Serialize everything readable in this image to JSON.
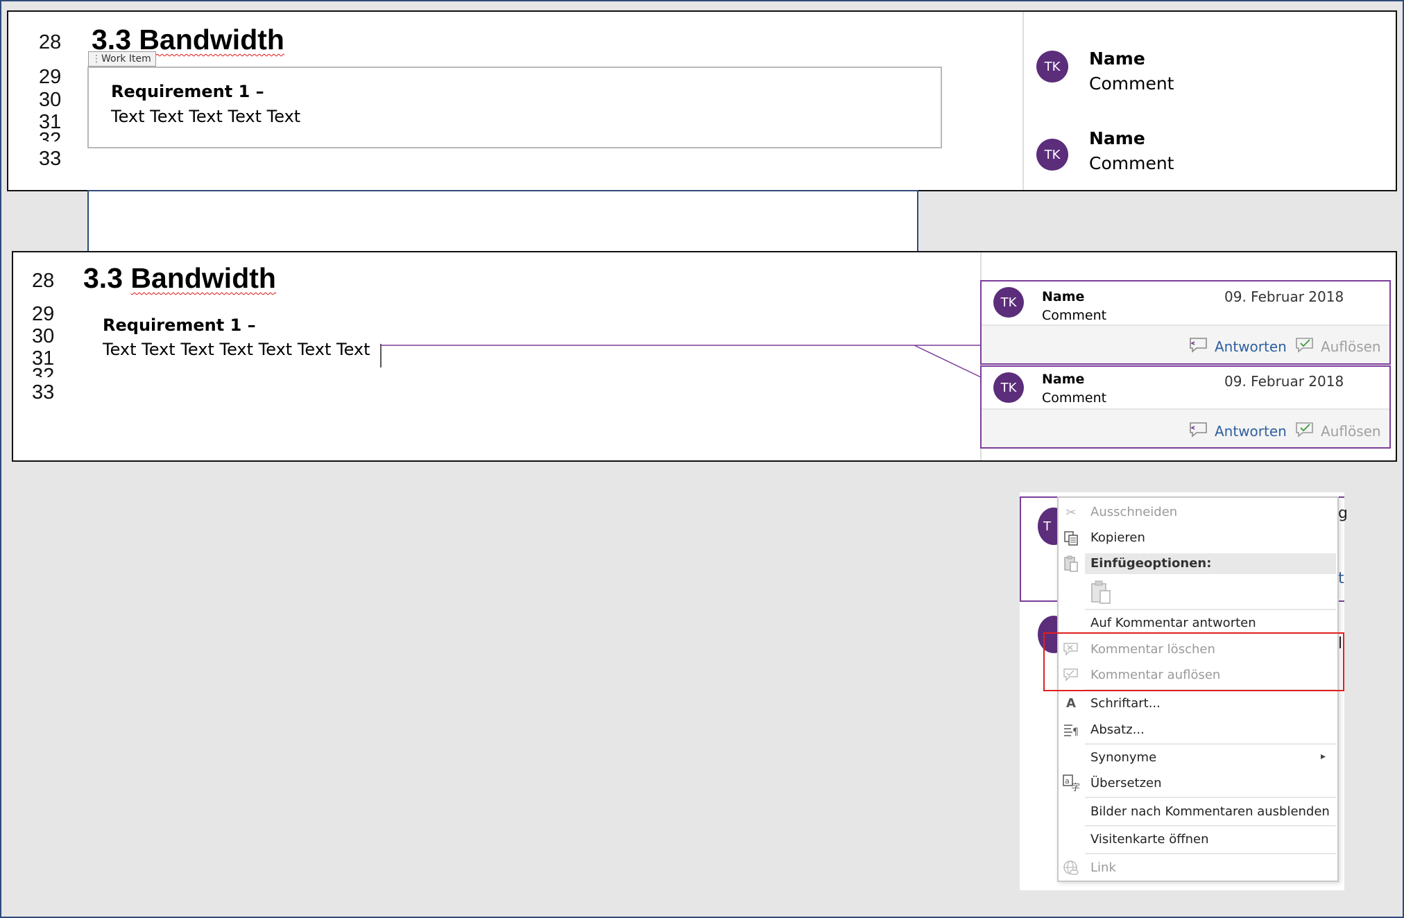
{
  "panel1": {
    "line_numbers": [
      "28",
      "29",
      "30",
      "31",
      "32",
      "33"
    ],
    "heading": "3.3 Bandwidth",
    "heading_number": "3.3",
    "heading_word": "Bandwidth",
    "work_item_label": "Work Item",
    "requirement_title": "Requirement 1 –",
    "requirement_text": "Text Text Text Text Text",
    "comments": [
      {
        "initials": "TK",
        "name": "Name",
        "text": "Comment"
      },
      {
        "initials": "TK",
        "name": "Name",
        "text": "Comment"
      }
    ]
  },
  "panel2": {
    "line_numbers": [
      "28",
      "29",
      "30",
      "31",
      "32",
      "33"
    ],
    "heading": "3.3 Bandwidth",
    "heading_number": "3.3",
    "heading_word": "Bandwidth",
    "requirement_title": "Requirement 1 –",
    "requirement_text": "Text Text Text Text Text Text Text",
    "comments": [
      {
        "initials": "TK",
        "name": "Name",
        "text": "Comment",
        "date": "09. Februar 2018",
        "reply_label": "Antworten",
        "resolve_label": "Auflösen"
      },
      {
        "initials": "TK",
        "name": "Name",
        "text": "Comment",
        "date": "09. Februar 2018",
        "reply_label": "Antworten",
        "resolve_label": "Auflösen"
      }
    ]
  },
  "context_menu": {
    "items": [
      {
        "icon": "scissors-icon",
        "label": "Ausschneiden",
        "enabled": false
      },
      {
        "icon": "copy-icon",
        "label": "Kopieren",
        "enabled": true
      },
      {
        "icon": "clipboard-icon",
        "label": "Einfügeoptionen:",
        "enabled": true
      },
      {
        "icon": "none",
        "label": "Auf Kommentar antworten",
        "enabled": true
      },
      {
        "icon": "delete-comment-icon",
        "label": "Kommentar löschen",
        "enabled": false
      },
      {
        "icon": "resolve-comment-icon",
        "label": "Kommentar auflösen",
        "enabled": false
      },
      {
        "icon": "font-icon",
        "label": "Schriftart...",
        "enabled": true
      },
      {
        "icon": "paragraph-icon",
        "label": "Absatz...",
        "enabled": true
      },
      {
        "icon": "none",
        "label": "Synonyme",
        "enabled": true
      },
      {
        "icon": "translate-icon",
        "label": "Übersetzen",
        "enabled": true
      },
      {
        "icon": "none",
        "label": "Bilder nach Kommentaren ausblenden",
        "enabled": true
      },
      {
        "icon": "none",
        "label": "Visitenkarte öffnen",
        "enabled": true
      },
      {
        "icon": "link-icon",
        "label": "Link",
        "enabled": false
      }
    ],
    "highlight_color": "#e02020",
    "behind_initial": "T",
    "behind_char_top": "g",
    "behind_char_link": "t",
    "behind_char_bottom": "l"
  },
  "colors": {
    "avatar": "#5c2d7b",
    "accent": "#7b3d9a",
    "link_blue": "#2e5f9e",
    "frame": "#2f4a7a"
  }
}
